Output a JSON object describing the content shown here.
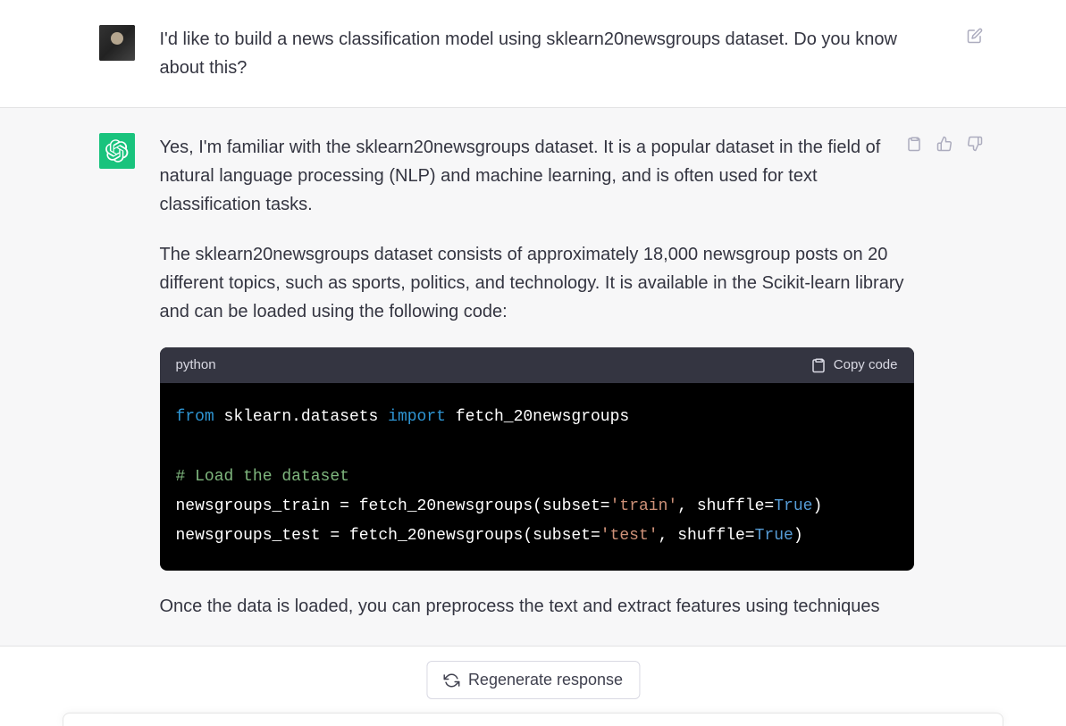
{
  "user_message": {
    "text": "I'd like to build a news classification model using sklearn20newsgroups dataset. Do you know about this?"
  },
  "assistant_message": {
    "paragraph1": "Yes, I'm familiar with the sklearn20newsgroups dataset. It is a popular dataset in the field of natural language processing (NLP) and machine learning, and is often used for text classification tasks.",
    "paragraph2": "The sklearn20newsgroups dataset consists of approximately 18,000 newsgroup posts on 20 different topics, such as sports, politics, and technology. It is available in the Scikit-learn library and can be loaded using the following code:",
    "paragraph3": "Once the data is loaded, you can preprocess the text and extract features using techniques"
  },
  "code": {
    "language": "python",
    "copy_label": "Copy code",
    "line1_kw1": "from",
    "line1_mod": " sklearn.datasets ",
    "line1_kw2": "import",
    "line1_fn": " fetch_20newsgroups",
    "line3_comment": "# Load the dataset",
    "line4_pre": "newsgroups_train = fetch_20newsgroups(subset=",
    "line4_str": "'train'",
    "line4_mid": ", shuffle=",
    "line4_bool": "True",
    "line4_end": ")",
    "line5_pre": "newsgroups_test = fetch_20newsgroups(subset=",
    "line5_str": "'test'",
    "line5_mid": ", shuffle=",
    "line5_bool": "True",
    "line5_end": ")"
  },
  "buttons": {
    "regenerate": "Regenerate response"
  }
}
